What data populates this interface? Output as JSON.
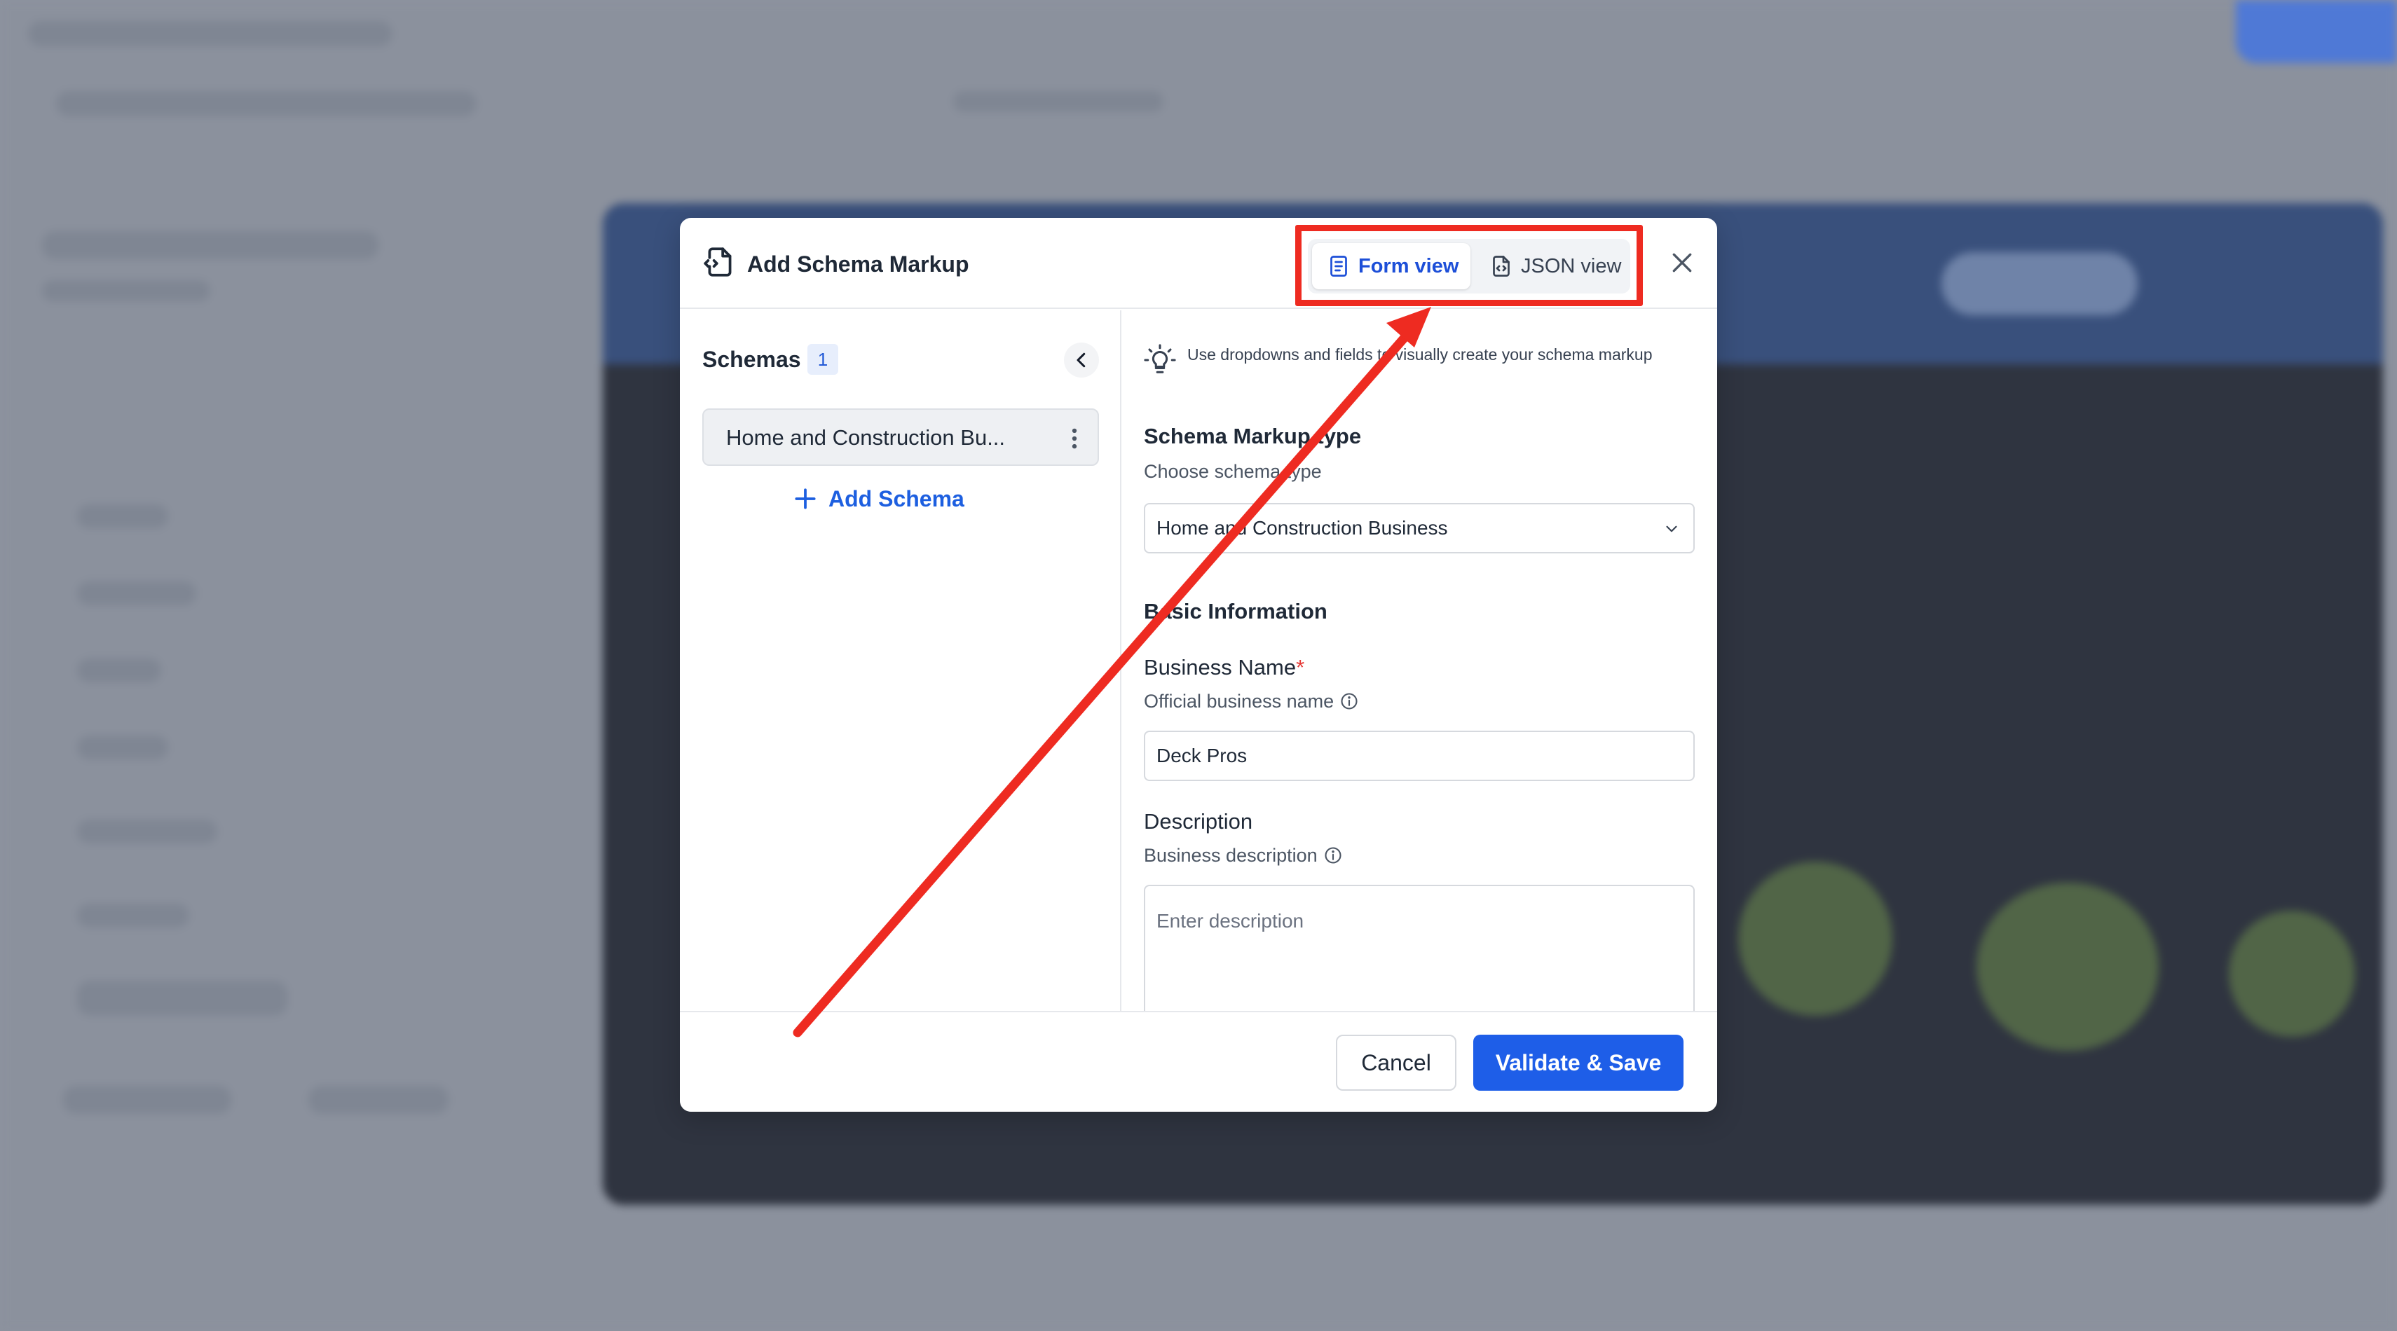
{
  "modal": {
    "title": "Add Schema Markup",
    "view_toggle": {
      "form_label": "Form view",
      "json_label": "JSON view",
      "active": "Form view"
    }
  },
  "left_pane": {
    "schemas_label": "Schemas",
    "schemas_count": "1",
    "items": [
      {
        "label": "Home and Construction Bu..."
      }
    ],
    "add_label": "Add Schema"
  },
  "right_pane": {
    "tip": "Use dropdowns and fields to visually create your schema markup",
    "schema_type": {
      "title": "Schema Markup type",
      "subtitle": "Choose schema type",
      "selected": "Home and Construction Business"
    },
    "basic_info_title": "Basic Information",
    "business_name": {
      "label": "Business Name",
      "required_mark": "*",
      "subtitle": "Official business name",
      "value": "Deck Pros"
    },
    "description": {
      "label": "Description",
      "subtitle": "Business description",
      "placeholder": "Enter description"
    }
  },
  "footer": {
    "cancel_label": "Cancel",
    "save_label": "Validate & Save"
  },
  "colors": {
    "accent": "#1e5ee8",
    "highlight": "#ee2b21",
    "arrow": "#ee2b21"
  }
}
